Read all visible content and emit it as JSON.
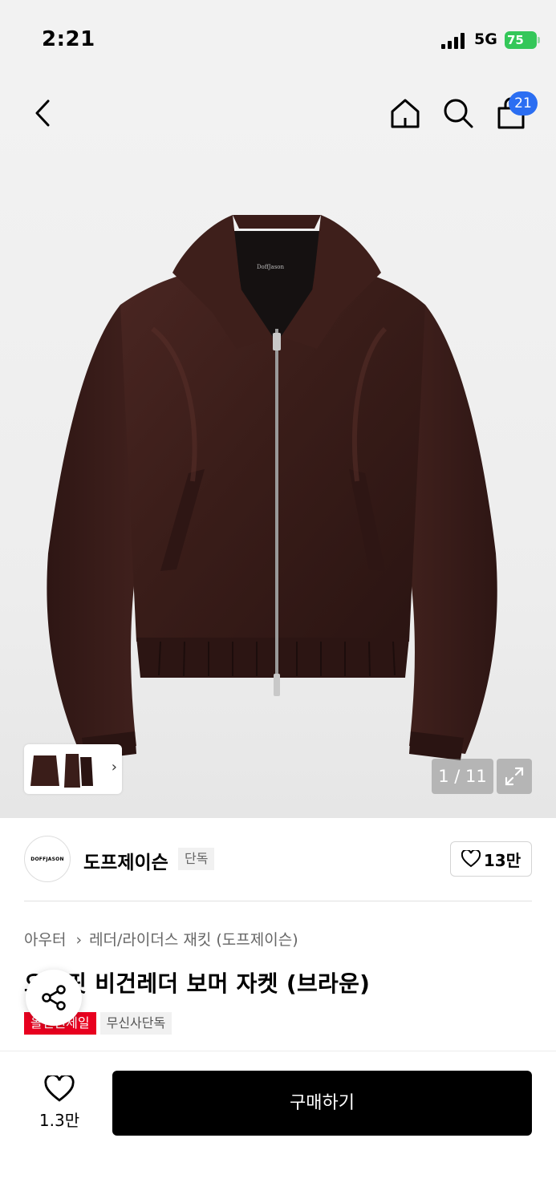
{
  "status_bar": {
    "time": "2:21",
    "network": "5G",
    "battery": "75"
  },
  "nav": {
    "cart_count": "21"
  },
  "gallery": {
    "page_counter": "1 / 11"
  },
  "brand": {
    "logo_text": "DOFFJASON",
    "name": "도프제이슨",
    "badge": "단독",
    "likes": "13만"
  },
  "product": {
    "breadcrumb": [
      "아우터",
      "레더/라이더스 재킷 (도프제이슨)"
    ],
    "title": "오버핏 비건레더 보머 자켓 (브라운)",
    "tags": [
      "올인원세일",
      "무신사단독"
    ]
  },
  "bottom": {
    "wishlist_count": "1.3만",
    "buy_label": "구매하기"
  },
  "colors": {
    "accent_blue": "#2b6ef2",
    "sale_red": "#e8001f",
    "battery_green": "#34c759",
    "jacket_brown": "#3d1e1a"
  },
  "icons": [
    "back-icon",
    "home-icon",
    "search-icon",
    "shopping-bag-icon",
    "chevron-right-icon",
    "expand-icon",
    "heart-icon",
    "share-icon"
  ]
}
